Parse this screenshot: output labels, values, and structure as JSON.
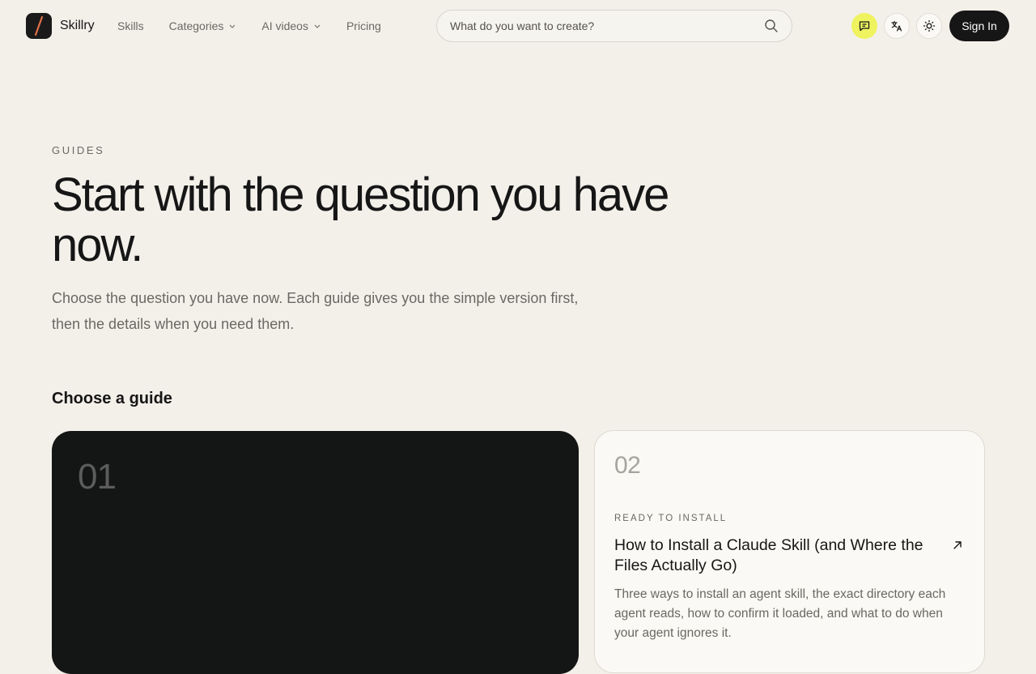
{
  "header": {
    "brand": "Skillry",
    "nav": {
      "skills": "Skills",
      "categories": "Categories",
      "ai_videos": "AI videos",
      "pricing": "Pricing"
    },
    "search": {
      "placeholder": "What do you want to create?"
    },
    "sign_in": "Sign In"
  },
  "hero": {
    "eyebrow": "GUIDES",
    "title": "Start with the question you have now.",
    "subtitle": "Choose the question you have now. Each guide gives you the simple version first, then the details when you need them."
  },
  "guides": {
    "heading": "Choose a guide",
    "cards": [
      {
        "number": "01"
      },
      {
        "number": "02",
        "tag": "READY TO INSTALL",
        "title": "How to Install a Claude Skill (and Where the Files Actually Go)",
        "description": "Three ways to install an agent skill, the exact directory each agent reads, how to confirm it loaded, and what to do when your agent ignores it."
      }
    ]
  },
  "colors": {
    "background": "#f3f0ea",
    "accent_yellow": "#eef35f",
    "dark": "#141515",
    "logo_slash": "#e0704a"
  }
}
